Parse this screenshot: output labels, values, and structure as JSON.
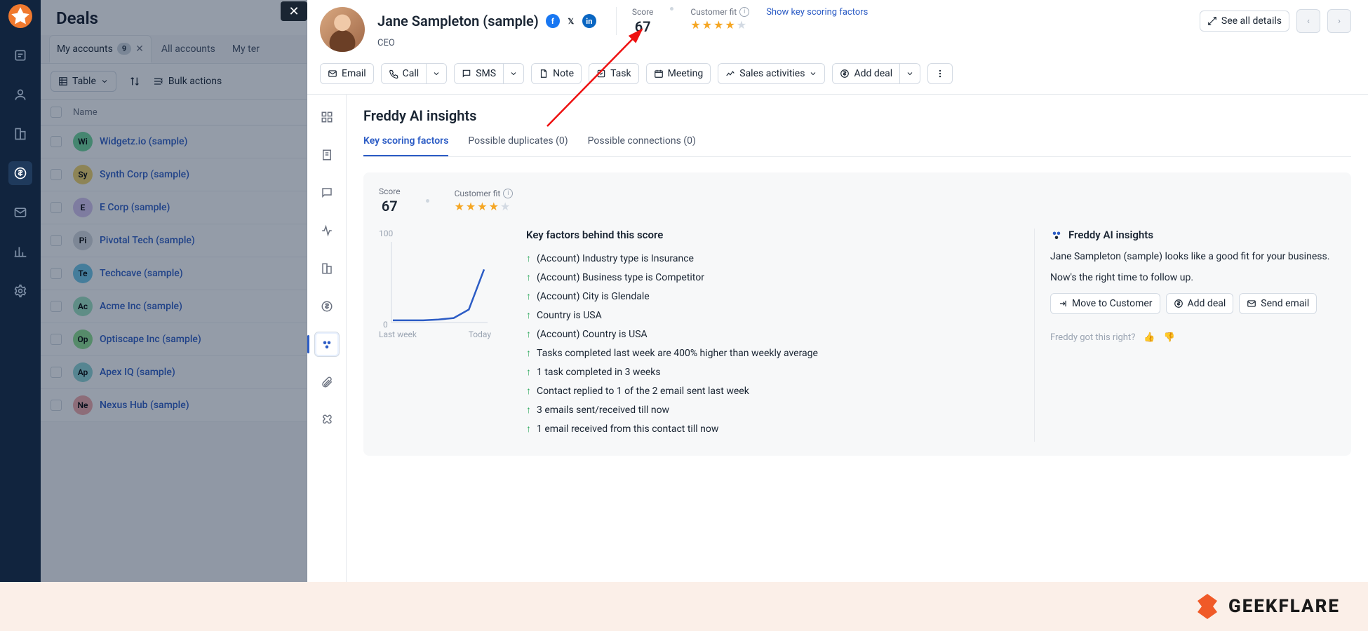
{
  "rail": {
    "items": [
      "notifications",
      "contacts",
      "accounts",
      "deals",
      "email",
      "analytics",
      "settings"
    ]
  },
  "deals": {
    "title": "Deals",
    "tabs": {
      "my_accounts": "My accounts",
      "my_accounts_count": "9",
      "all_accounts": "All accounts",
      "my_ter": "My ter"
    },
    "toolbar": {
      "table": "Table",
      "bulk": "Bulk actions"
    },
    "col_name": "Name",
    "rows": [
      {
        "abbr": "Wi",
        "color": "#6fd89a",
        "name": "Widgetz.io (sample)"
      },
      {
        "abbr": "Sy",
        "color": "#f3d36b",
        "name": "Synth Corp (sample)"
      },
      {
        "abbr": "E",
        "color": "#d8c5f0",
        "name": "E Corp (sample)"
      },
      {
        "abbr": "Pi",
        "color": "#d6d9de",
        "name": "Pivotal Tech (sample)"
      },
      {
        "abbr": "Te",
        "color": "#6fc6e8",
        "name": "Techcave (sample)"
      },
      {
        "abbr": "Ac",
        "color": "#9fe3c2",
        "name": "Acme Inc (sample)"
      },
      {
        "abbr": "Op",
        "color": "#8fe08f",
        "name": "Optiscape Inc (sample)"
      },
      {
        "abbr": "Ap",
        "color": "#8fd6d6",
        "name": "Apex IQ (sample)"
      },
      {
        "abbr": "Ne",
        "color": "#f3a9a9",
        "name": "Nexus Hub (sample)"
      }
    ]
  },
  "contact": {
    "name": "Jane Sampleton (sample)",
    "role": "CEO",
    "score_label": "Score",
    "score": "67",
    "fit_label": "Customer fit",
    "fit_stars": 4,
    "show_factors": "Show key scoring factors",
    "see_all": "See all details"
  },
  "actions": {
    "email": "Email",
    "call": "Call",
    "sms": "SMS",
    "note": "Note",
    "task": "Task",
    "meeting": "Meeting",
    "sales": "Sales activities",
    "add_deal": "Add deal"
  },
  "insights": {
    "title": "Freddy AI insights",
    "tabs": {
      "key": "Key scoring factors",
      "dup": "Possible duplicates (0)",
      "conn": "Possible connections (0)"
    },
    "factors_title": "Key factors behind this score",
    "factors": [
      "(Account) Industry type is Insurance",
      "(Account) Business type is Competitor",
      "(Account) City is Glendale",
      "Country is USA",
      "(Account) Country is USA",
      "Tasks completed last week are 400% higher than weekly average",
      "1 task completed in 3 weeks",
      "Contact replied to 1 of the 2 email sent last week",
      "3 emails sent/received till now",
      "1 email received from this contact till now"
    ],
    "right_title": "Freddy AI insights",
    "right_p1": "Jane Sampleton (sample) looks like a good fit for your business.",
    "right_p2": "Now's the right time to follow up.",
    "move": "Move to Customer",
    "add": "Add deal",
    "send": "Send email",
    "feedback": "Freddy got this right?"
  },
  "chart_data": {
    "type": "line",
    "title": "",
    "xlabel": "",
    "ylabel": "",
    "ylim": [
      0,
      100
    ],
    "x_ticks": [
      "Last week",
      "Today"
    ],
    "x": [
      0,
      1,
      2,
      3,
      4,
      5,
      6
    ],
    "values": [
      1,
      1,
      1,
      2,
      4,
      15,
      67
    ]
  },
  "chart_labels": {
    "y100": "100",
    "y0": "0",
    "xl": "Last week",
    "xr": "Today"
  },
  "footer": {
    "brand": "GEEKFLARE"
  }
}
